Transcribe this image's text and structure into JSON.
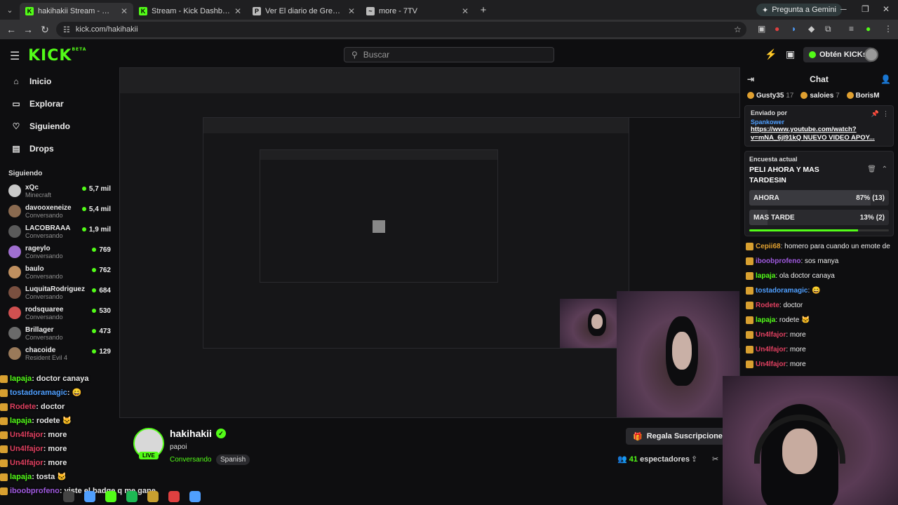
{
  "browser": {
    "tabs": [
      {
        "title": "hakihakii Stream - Watch Live o",
        "active": true,
        "fav_color": "#53fc18",
        "fav_glyph": "K"
      },
      {
        "title": "Stream - Kick Dashboard",
        "active": false,
        "fav_color": "#53fc18",
        "fav_glyph": "K"
      },
      {
        "title": "Ver El diario de Greg 2: La ley d",
        "active": false,
        "fav_color": "#bbbbbb",
        "fav_glyph": "P"
      },
      {
        "title": "more - 7TV",
        "active": false,
        "fav_color": "#bbbbbb",
        "fav_glyph": "~"
      }
    ],
    "gemini_label": "Pregunta a Gemini",
    "url": "kick.com/hakihakii"
  },
  "kick": {
    "logo": "KICK",
    "logo_beta": "BETA",
    "search_placeholder": "Buscar",
    "kicks_button": "Obtén KICKs",
    "nav": [
      {
        "label": "Inicio",
        "icon": "home-icon",
        "glyph": "⌂"
      },
      {
        "label": "Explorar",
        "icon": "compass-icon",
        "glyph": "▭"
      },
      {
        "label": "Siguiendo",
        "icon": "heart-icon",
        "glyph": "♡"
      },
      {
        "label": "Drops",
        "icon": "drops-icon",
        "glyph": "▤"
      }
    ],
    "following_title": "Siguiendo",
    "channels": [
      {
        "name": "xQc",
        "category": "Minecraft",
        "viewers": "5,7 mil",
        "color": "#c9c9c9"
      },
      {
        "name": "davooxeneize",
        "category": "Conversando",
        "viewers": "5,4 mil",
        "color": "#8a6a50"
      },
      {
        "name": "LACOBRAAA",
        "category": "Conversando",
        "viewers": "1,9 mil",
        "color": "#5a5a5a"
      },
      {
        "name": "rageylo",
        "category": "Conversando",
        "viewers": "769",
        "color": "#a06fd0"
      },
      {
        "name": "baulo",
        "category": "Conversando",
        "viewers": "762",
        "color": "#c09060"
      },
      {
        "name": "LuquitaRodriguez",
        "category": "Conversando",
        "viewers": "684",
        "color": "#7a5040"
      },
      {
        "name": "rodsquaree",
        "category": "Conversando",
        "viewers": "530",
        "color": "#d05050"
      },
      {
        "name": "Brillager",
        "category": "Conversando",
        "viewers": "473",
        "color": "#6a6a6a"
      },
      {
        "name": "chacoide",
        "category": "Resident Evil 4",
        "viewers": "129",
        "color": "#9a7a5a"
      }
    ],
    "streamer": {
      "name": "hakihakii",
      "title": "papoi",
      "category": "Conversando",
      "tag": "Spanish",
      "live": "LIVE",
      "gift_button": "Regala Suscripciones",
      "viewers_count": "41",
      "viewers_label": "espectadores"
    },
    "chat": {
      "title": "Chat",
      "gifters": [
        {
          "name": "Gusty35",
          "count": "17"
        },
        {
          "name": "saloies",
          "count": "7"
        },
        {
          "name": "BorisM",
          "count": ""
        }
      ],
      "pinned": {
        "label": "Enviado por",
        "user": "Spankower",
        "message": "https://www.youtube.com/watch?v=mNA_6jI91kQ NUEVO VIDEO APOY..."
      },
      "poll": {
        "label": "Encuesta actual",
        "question": "PELI AHORA Y MAS TARDESIN",
        "options": [
          {
            "text": "AHORA",
            "percent": "87%",
            "votes": "(13)",
            "share": 0.87
          },
          {
            "text": "MAS TARDE",
            "percent": "13%",
            "votes": "(2)",
            "share": 0.13
          }
        ],
        "time_remaining_share": 0.78
      },
      "messages": [
        {
          "user": "Cepii68",
          "text": "homero para cuando un emote de homero homosexual?",
          "color": "#e0a030"
        },
        {
          "user": "iboobprofeno",
          "text": "sos manya",
          "color": "#a05ae0"
        },
        {
          "user": "lapaja",
          "text": "ola doctor canaya",
          "color": "#53fc18"
        },
        {
          "user": "tostadoramagic",
          "text": "😄",
          "color": "#4f9fff"
        },
        {
          "user": "Rodete",
          "text": "doctor",
          "color": "#e04060"
        },
        {
          "user": "lapaja",
          "text": "rodete 🐱",
          "color": "#53fc18"
        },
        {
          "user": "Un4lfajor",
          "text": "more",
          "color": "#e04060"
        },
        {
          "user": "Un4lfajor",
          "text": "more",
          "color": "#e04060"
        },
        {
          "user": "Un4lfajor",
          "text": "more",
          "color": "#e04060"
        }
      ]
    },
    "overlay_chat": [
      {
        "user": "lapaja",
        "text": "doctor canaya",
        "color": "#53fc18"
      },
      {
        "user": "tostadoramagic",
        "text": "😄",
        "color": "#4f9fff"
      },
      {
        "user": "Rodete",
        "text": "doctor",
        "color": "#e04060"
      },
      {
        "user": "lapaja",
        "text": "rodete 🐱",
        "color": "#53fc18"
      },
      {
        "user": "Un4lfajor",
        "text": "more",
        "color": "#e04060"
      },
      {
        "user": "Un4lfajor",
        "text": "more",
        "color": "#e04060"
      },
      {
        "user": "Un4lfajor",
        "text": "more",
        "color": "#e04060"
      },
      {
        "user": "lapaja",
        "text": "tosta 🐱",
        "color": "#53fc18"
      },
      {
        "user": "iboobprofeno",
        "text": "viste el badge q me gane",
        "color": "#a05ae0"
      }
    ],
    "colors": {
      "accent": "#53fc18",
      "bg": "#0e0e10"
    }
  }
}
